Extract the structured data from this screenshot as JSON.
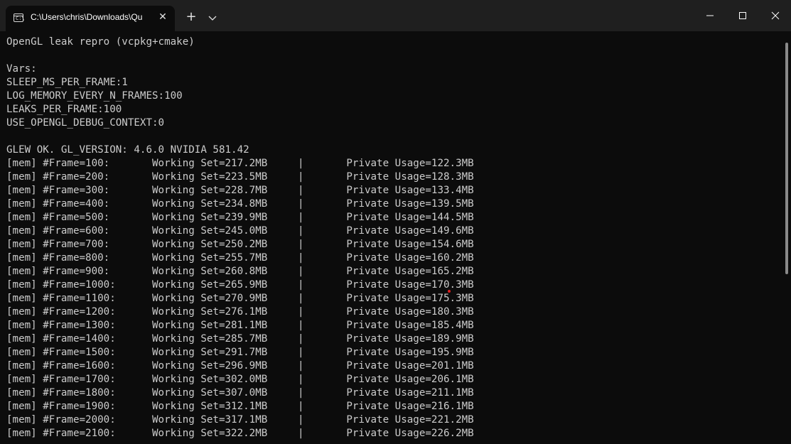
{
  "tab": {
    "title": "C:\\Users\\chris\\Downloads\\Qu",
    "icon": "terminal-icon"
  },
  "controls": {
    "new_tab": "+",
    "close_tab": "✕"
  },
  "terminal": {
    "lines": [
      "OpenGL leak repro (vcpkg+cmake)",
      "",
      "Vars:",
      "SLEEP_MS_PER_FRAME:1",
      "LOG_MEMORY_EVERY_N_FRAMES:100",
      "LEAKS_PER_FRAME:100",
      "USE_OPENGL_DEBUG_CONTEXT:0",
      "",
      "GLEW OK. GL_VERSION: 4.6.0 NVIDIA 581.42",
      "[mem] #Frame=100:       Working Set=217.2MB     |       Private Usage=122.3MB",
      "[mem] #Frame=200:       Working Set=223.5MB     |       Private Usage=128.3MB",
      "[mem] #Frame=300:       Working Set=228.7MB     |       Private Usage=133.4MB",
      "[mem] #Frame=400:       Working Set=234.8MB     |       Private Usage=139.5MB",
      "[mem] #Frame=500:       Working Set=239.9MB     |       Private Usage=144.5MB",
      "[mem] #Frame=600:       Working Set=245.0MB     |       Private Usage=149.6MB",
      "[mem] #Frame=700:       Working Set=250.2MB     |       Private Usage=154.6MB",
      "[mem] #Frame=800:       Working Set=255.7MB     |       Private Usage=160.2MB",
      "[mem] #Frame=900:       Working Set=260.8MB     |       Private Usage=165.2MB",
      "[mem] #Frame=1000:      Working Set=265.9MB     |       Private Usage=170.3MB",
      "[mem] #Frame=1100:      Working Set=270.9MB     |       Private Usage=175.3MB",
      "[mem] #Frame=1200:      Working Set=276.1MB     |       Private Usage=180.3MB",
      "[mem] #Frame=1300:      Working Set=281.1MB     |       Private Usage=185.4MB",
      "[mem] #Frame=1400:      Working Set=285.7MB     |       Private Usage=189.9MB",
      "[mem] #Frame=1500:      Working Set=291.7MB     |       Private Usage=195.9MB",
      "[mem] #Frame=1600:      Working Set=296.9MB     |       Private Usage=201.1MB",
      "[mem] #Frame=1700:      Working Set=302.0MB     |       Private Usage=206.1MB",
      "[mem] #Frame=1800:      Working Set=307.0MB     |       Private Usage=211.1MB",
      "[mem] #Frame=1900:      Working Set=312.1MB     |       Private Usage=216.1MB",
      "[mem] #Frame=2000:      Working Set=317.1MB     |       Private Usage=221.2MB",
      "[mem] #Frame=2100:      Working Set=322.2MB     |       Private Usage=226.2MB"
    ]
  }
}
